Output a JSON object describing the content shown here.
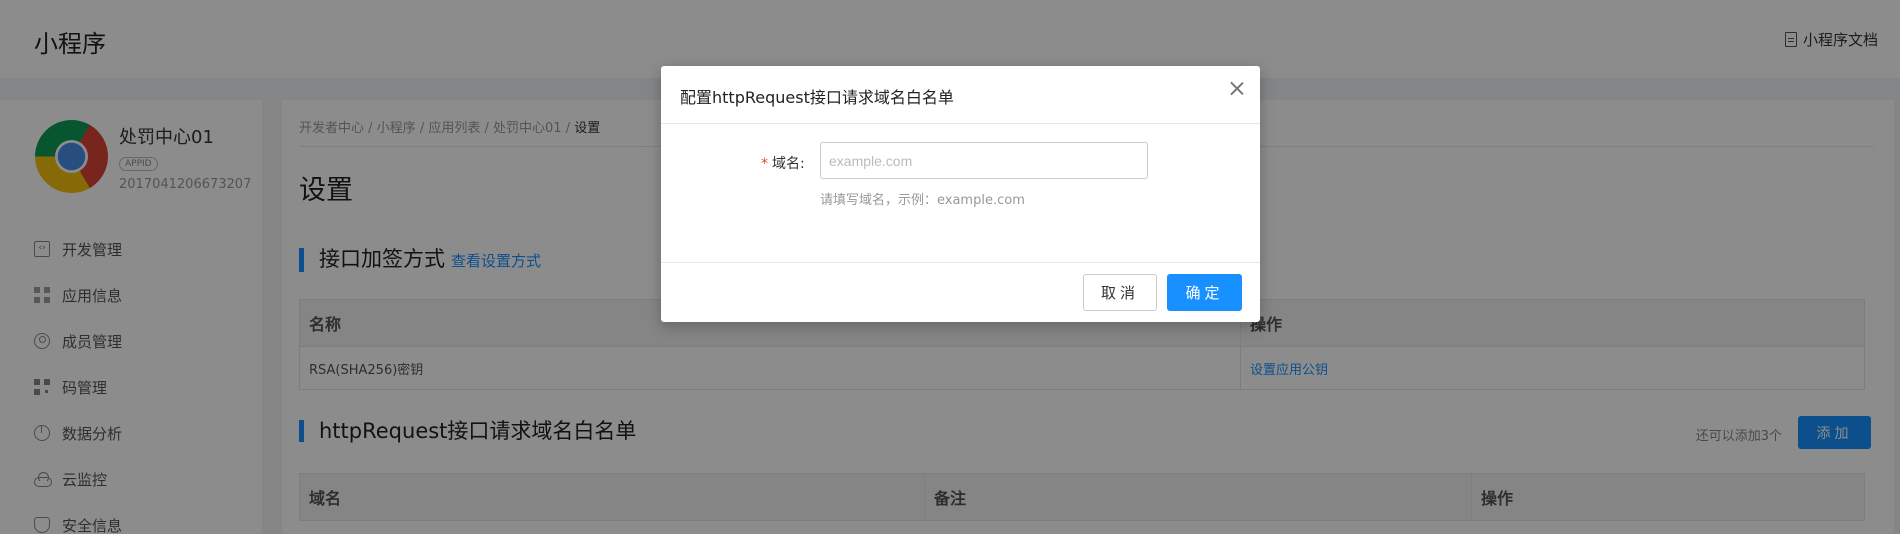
{
  "header": {
    "brand": "小程序",
    "doc_link": "小程序文档"
  },
  "sidebar": {
    "app_name": "处罚中心01",
    "appid_badge": "APPID",
    "appid_value": "2017041206673207",
    "items": [
      {
        "label": "开发管理",
        "icon": "code-icon"
      },
      {
        "label": "应用信息",
        "icon": "grid-icon"
      },
      {
        "label": "成员管理",
        "icon": "user-icon"
      },
      {
        "label": "码管理",
        "icon": "qrcode-icon"
      },
      {
        "label": "数据分析",
        "icon": "pie-chart-icon"
      },
      {
        "label": "云监控",
        "icon": "cloud-icon"
      },
      {
        "label": "安全信息",
        "icon": "shield-icon"
      }
    ]
  },
  "breadcrumb": {
    "items": [
      "开发者中心",
      "小程序",
      "应用列表",
      "处罚中心01"
    ],
    "current": "设置",
    "separator": " / "
  },
  "page": {
    "title": "设置"
  },
  "sign_section": {
    "title": "接口加签方式",
    "link": "查看设置方式",
    "columns": [
      "名称",
      "操作"
    ],
    "rows": [
      {
        "name": "RSA(SHA256)密钥",
        "action": "设置应用公钥"
      }
    ]
  },
  "whitelist_section": {
    "title": "httpRequest接口请求域名白名单",
    "quota_text": "还可以添加3个",
    "add_button": "添加",
    "columns": [
      "域名",
      "备注",
      "操作"
    ]
  },
  "modal": {
    "title": "配置httpRequest接口请求域名白名单",
    "field_label": "域名:",
    "required_mark": "*",
    "input_placeholder": "example.com",
    "input_value": "",
    "hint": "请填写域名，示例：example.com",
    "cancel_label": "取消",
    "ok_label": "确定"
  },
  "colors": {
    "primary": "#1890ff",
    "required": "#f04134"
  }
}
